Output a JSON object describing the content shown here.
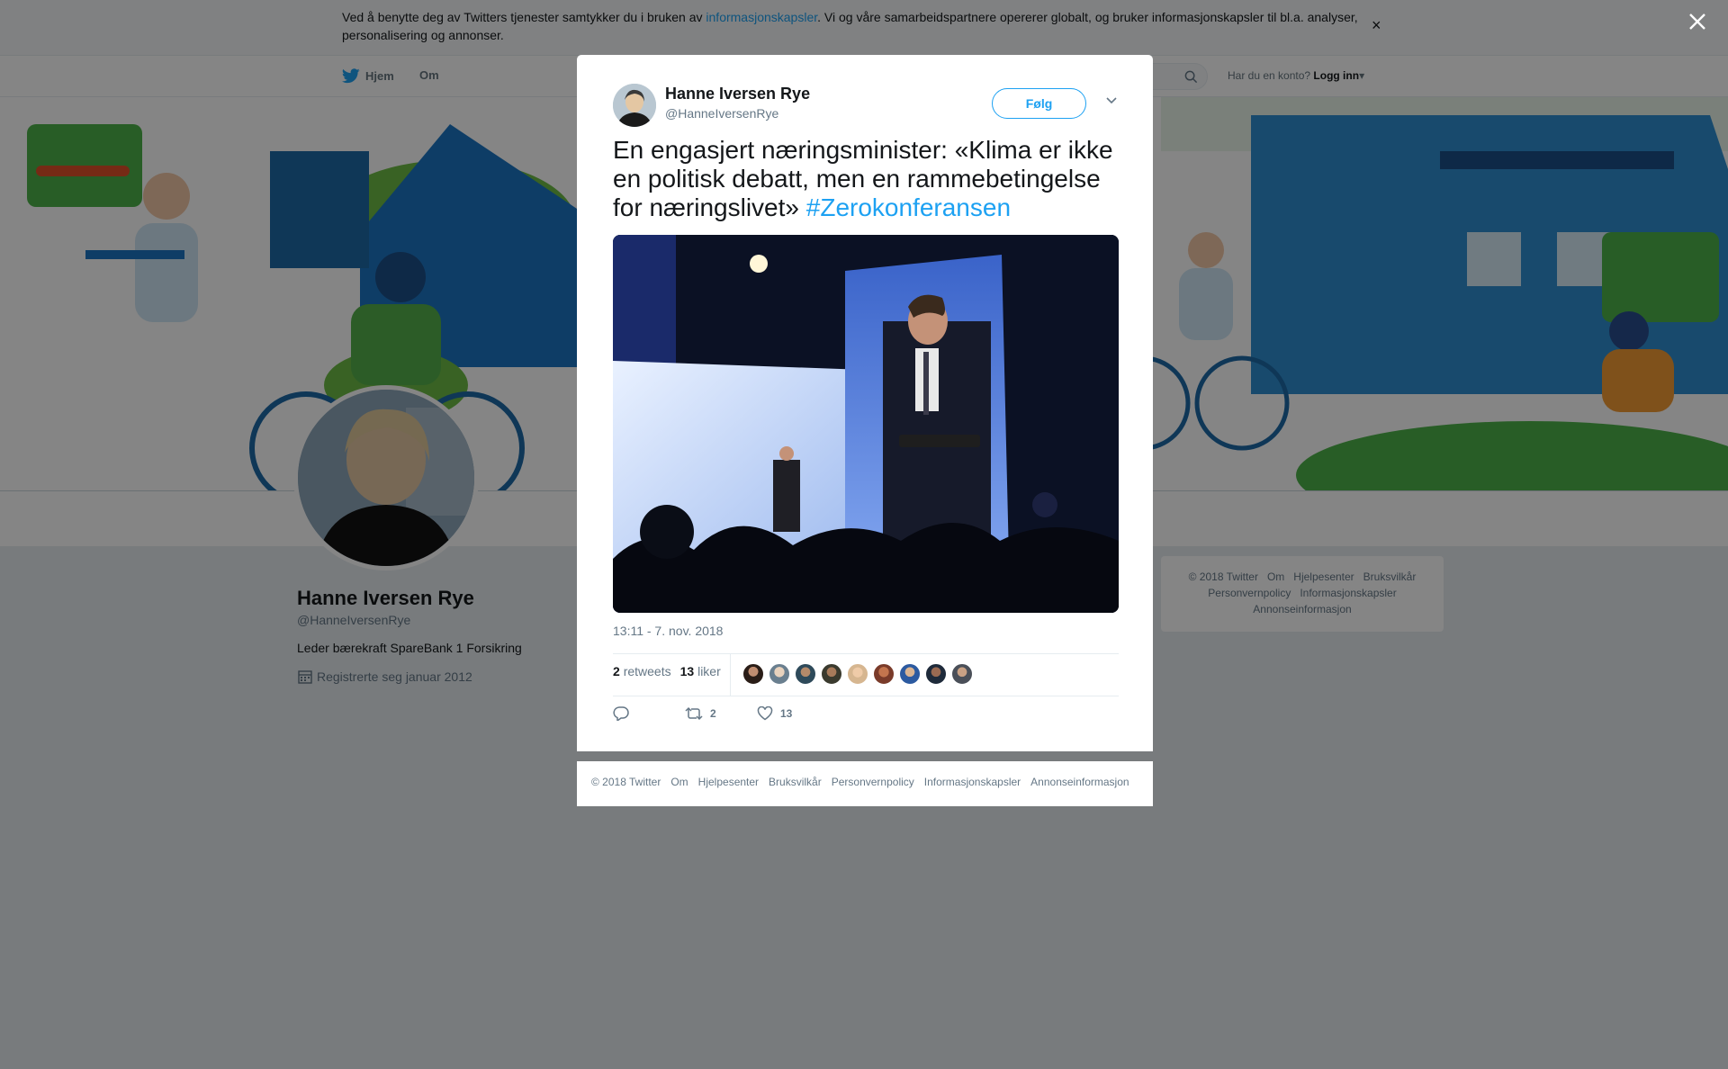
{
  "cookie_bar": {
    "text_before": "Ved å benytte deg av Twitters tjenester samtykker du i bruken av ",
    "link": "informasjonskapsler",
    "text_after": ". Vi og våre samarbeidspartnere opererer globalt, og bruker informasjonskapsler til bl.a. analyser, personalisering og annonser.",
    "close": "×"
  },
  "nav": {
    "home": "Hjem",
    "about": "Om",
    "account_prompt": "Har du en konto?",
    "login": "Logg inn"
  },
  "profile": {
    "name": "Hanne Iversen Rye",
    "handle": "@HanneIversenRye",
    "bio": "Leder bærekraft SpareBank 1 Forsikring",
    "joined": "Registrerte seg januar 2012"
  },
  "side_footer": {
    "links": [
      "© 2018 Twitter",
      "Om",
      "Hjelpesenter",
      "Bruksvilkår",
      "Personvernpolicy",
      "Informasjonskapsler",
      "Annonseinformasjon"
    ]
  },
  "tweet": {
    "name": "Hanne Iversen Rye",
    "handle": "@HanneIversenRye",
    "follow_label": "Følg",
    "text": "En engasjert næringsminister: «Klima er ikke en politisk debatt, men en rammebetingelse for næringslivet» ",
    "hashtag": "#Zerokonferansen",
    "timestamp": "13:11 - 7. nov. 2018",
    "retweets_count": "2",
    "retweets_label": "retweets",
    "likes_count": "13",
    "likes_label": "liker",
    "action_retweet_count": "2",
    "action_like_count": "13"
  },
  "modal_footer": {
    "links": [
      "© 2018 Twitter",
      "Om",
      "Hjelpesenter",
      "Bruksvilkår",
      "Personvernpolicy",
      "Informasjonskapsler",
      "Annonseinformasjon"
    ]
  },
  "icons": {
    "close_overlay": "close-icon",
    "bird": "twitter-bird-icon",
    "search": "search-icon",
    "calendar": "calendar-icon",
    "reply": "reply-icon",
    "retweet": "retweet-icon",
    "like": "heart-icon",
    "caret": "chevron-down-icon"
  },
  "colors": {
    "accent": "#1da1f2",
    "text": "#14171a",
    "muted": "#657786"
  }
}
